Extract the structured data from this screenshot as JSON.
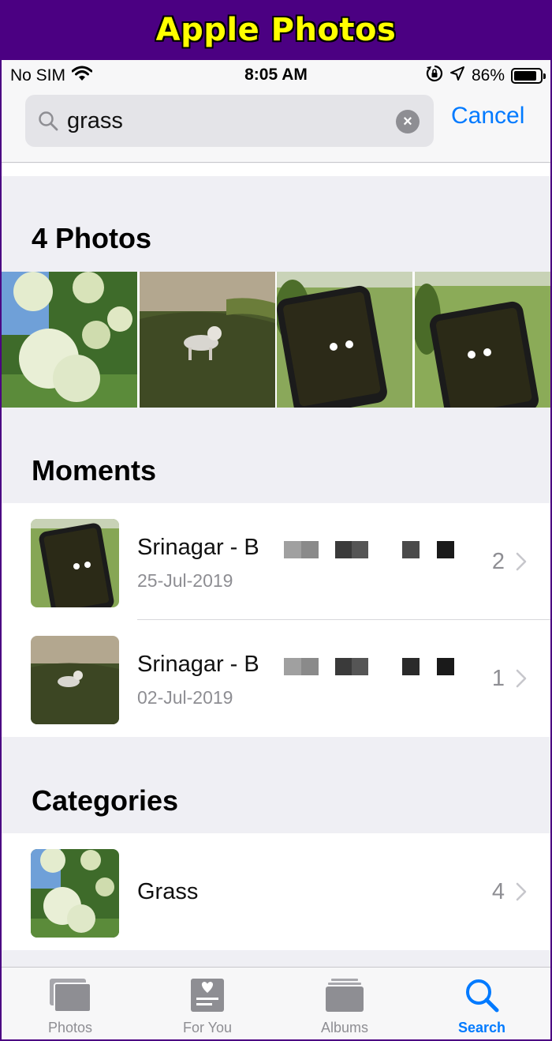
{
  "banner": {
    "title": "Apple Photos"
  },
  "status_bar": {
    "carrier": "No SIM",
    "time": "8:05 AM",
    "battery": "86%",
    "battery_level": 0.86
  },
  "search": {
    "value": "grass",
    "cancel_label": "Cancel"
  },
  "photos_section": {
    "title": "4 Photos"
  },
  "moments_section": {
    "title": "Moments",
    "items": [
      {
        "title": "Srinagar - B",
        "date": "25-Jul-2019",
        "count": "2"
      },
      {
        "title": "Srinagar - B",
        "date": "02-Jul-2019",
        "count": "1"
      }
    ]
  },
  "categories_section": {
    "title": "Categories",
    "items": [
      {
        "title": "Grass",
        "count": "4"
      }
    ]
  },
  "tab_bar": {
    "tabs": [
      {
        "label": "Photos"
      },
      {
        "label": "For You"
      },
      {
        "label": "Albums"
      },
      {
        "label": "Search"
      }
    ]
  },
  "colors": {
    "banner_bg": "#4b0082",
    "banner_text": "#ffff00",
    "accent": "#007aff"
  }
}
